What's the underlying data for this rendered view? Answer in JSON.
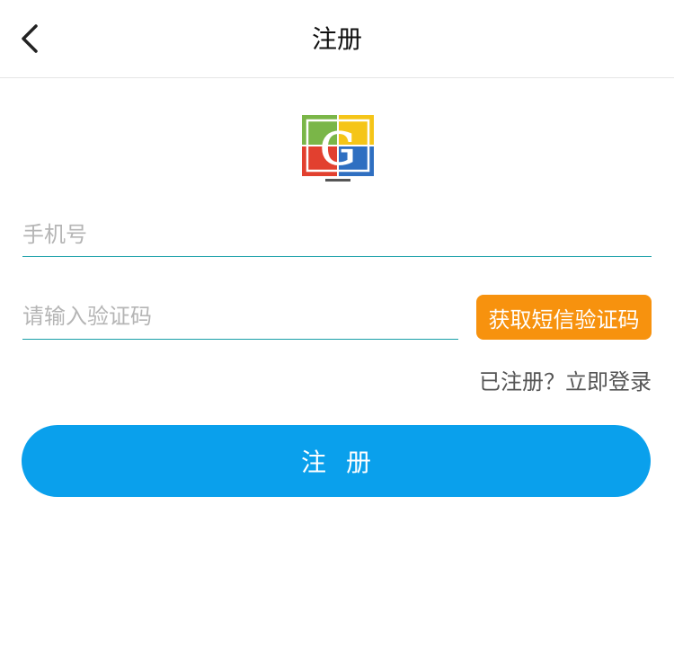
{
  "header": {
    "title": "注册",
    "back_icon": "chevron-left-icon"
  },
  "logo": {
    "letter": "G",
    "colors": {
      "green": "#7ab648",
      "yellow": "#f5c518",
      "red": "#e2402f",
      "blue": "#2f6fc1"
    }
  },
  "form": {
    "phone_placeholder": "手机号",
    "code_placeholder": "请输入验证码",
    "sms_button_label": "获取短信验证码",
    "login_link": "已注册？立即登录",
    "submit_label": "注册"
  },
  "colors": {
    "accent": "#0aa0ec",
    "sms_button": "#f7920e",
    "field_underline": "#1aa0a8"
  }
}
